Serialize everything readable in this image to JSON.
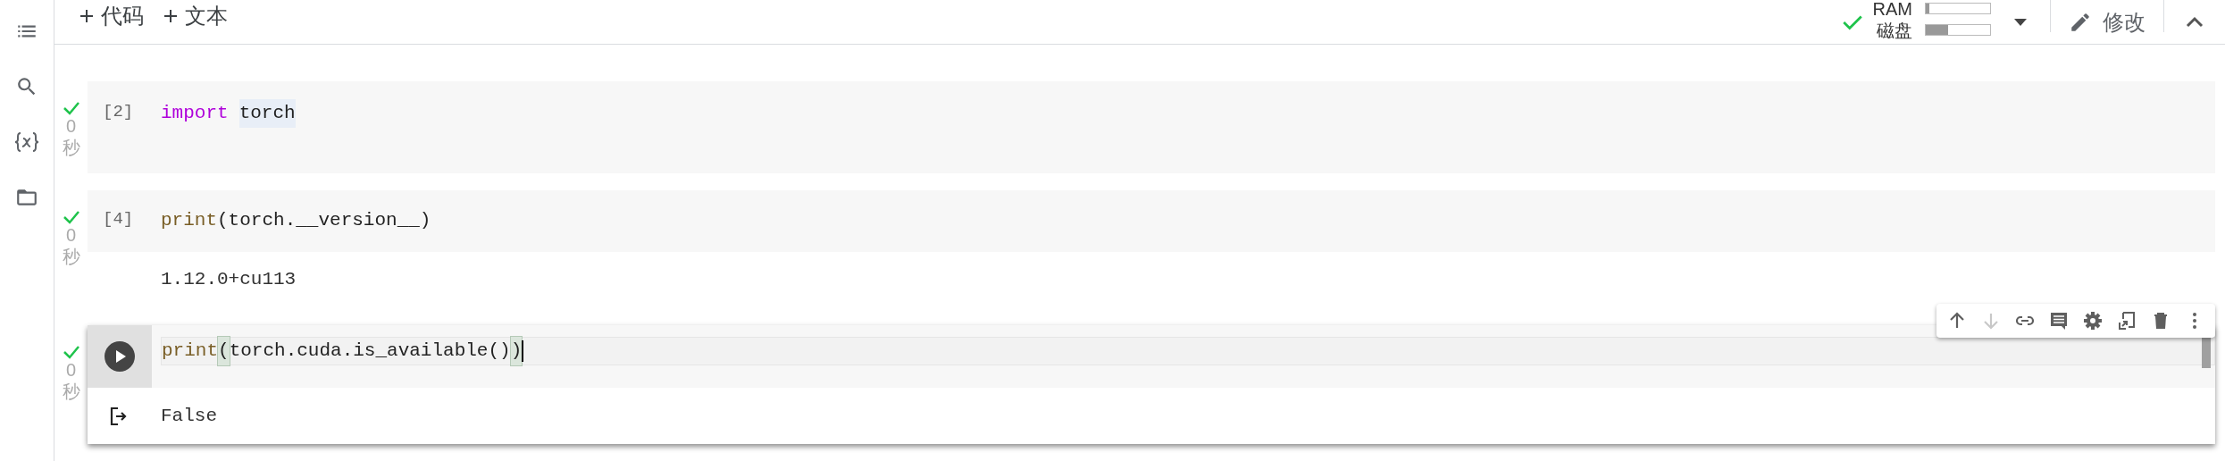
{
  "toolbar": {
    "buttons": [
      {
        "label": "代码"
      },
      {
        "label": "文本"
      }
    ]
  },
  "resources": {
    "connected": true,
    "meters": [
      {
        "label": "RAM",
        "level": 0.05
      },
      {
        "label": "磁盘",
        "level": 0.35
      }
    ]
  },
  "edit_button": {
    "label": "修改"
  },
  "cells": [
    {
      "exec_count": "[2]",
      "done": true,
      "duration": "0 秒",
      "focused": false,
      "code": [
        {
          "text": "import",
          "kind": "keyword"
        },
        {
          "text": "torch",
          "kind": "highlighted"
        }
      ]
    },
    {
      "exec_count": "[4]",
      "done": true,
      "duration": "0 秒",
      "focused": false,
      "code": [
        {
          "text": "print",
          "kind": "builtin"
        },
        {
          "text": "(torch.__version__)",
          "kind": "plain"
        }
      ],
      "output": "1.12.0+cu113"
    },
    {
      "done": true,
      "duration": "0 秒",
      "focused": true,
      "code": [
        {
          "text": "print",
          "kind": "builtin"
        },
        {
          "text": "(",
          "kind": "bracket"
        },
        {
          "text": "torch.cuda.is_available()",
          "kind": "plain"
        },
        {
          "text": ")",
          "kind": "bracket"
        }
      ],
      "output": "False"
    }
  ],
  "cell_toolbar": {
    "actions": [
      {
        "kind": "up",
        "disabled": false
      },
      {
        "kind": "down",
        "disabled": true
      },
      {
        "kind": "link",
        "disabled": false
      },
      {
        "kind": "comment",
        "disabled": false
      },
      {
        "kind": "settings",
        "disabled": false
      },
      {
        "kind": "mirror",
        "disabled": false
      },
      {
        "kind": "delete",
        "disabled": false
      },
      {
        "kind": "more",
        "disabled": false
      }
    ]
  }
}
